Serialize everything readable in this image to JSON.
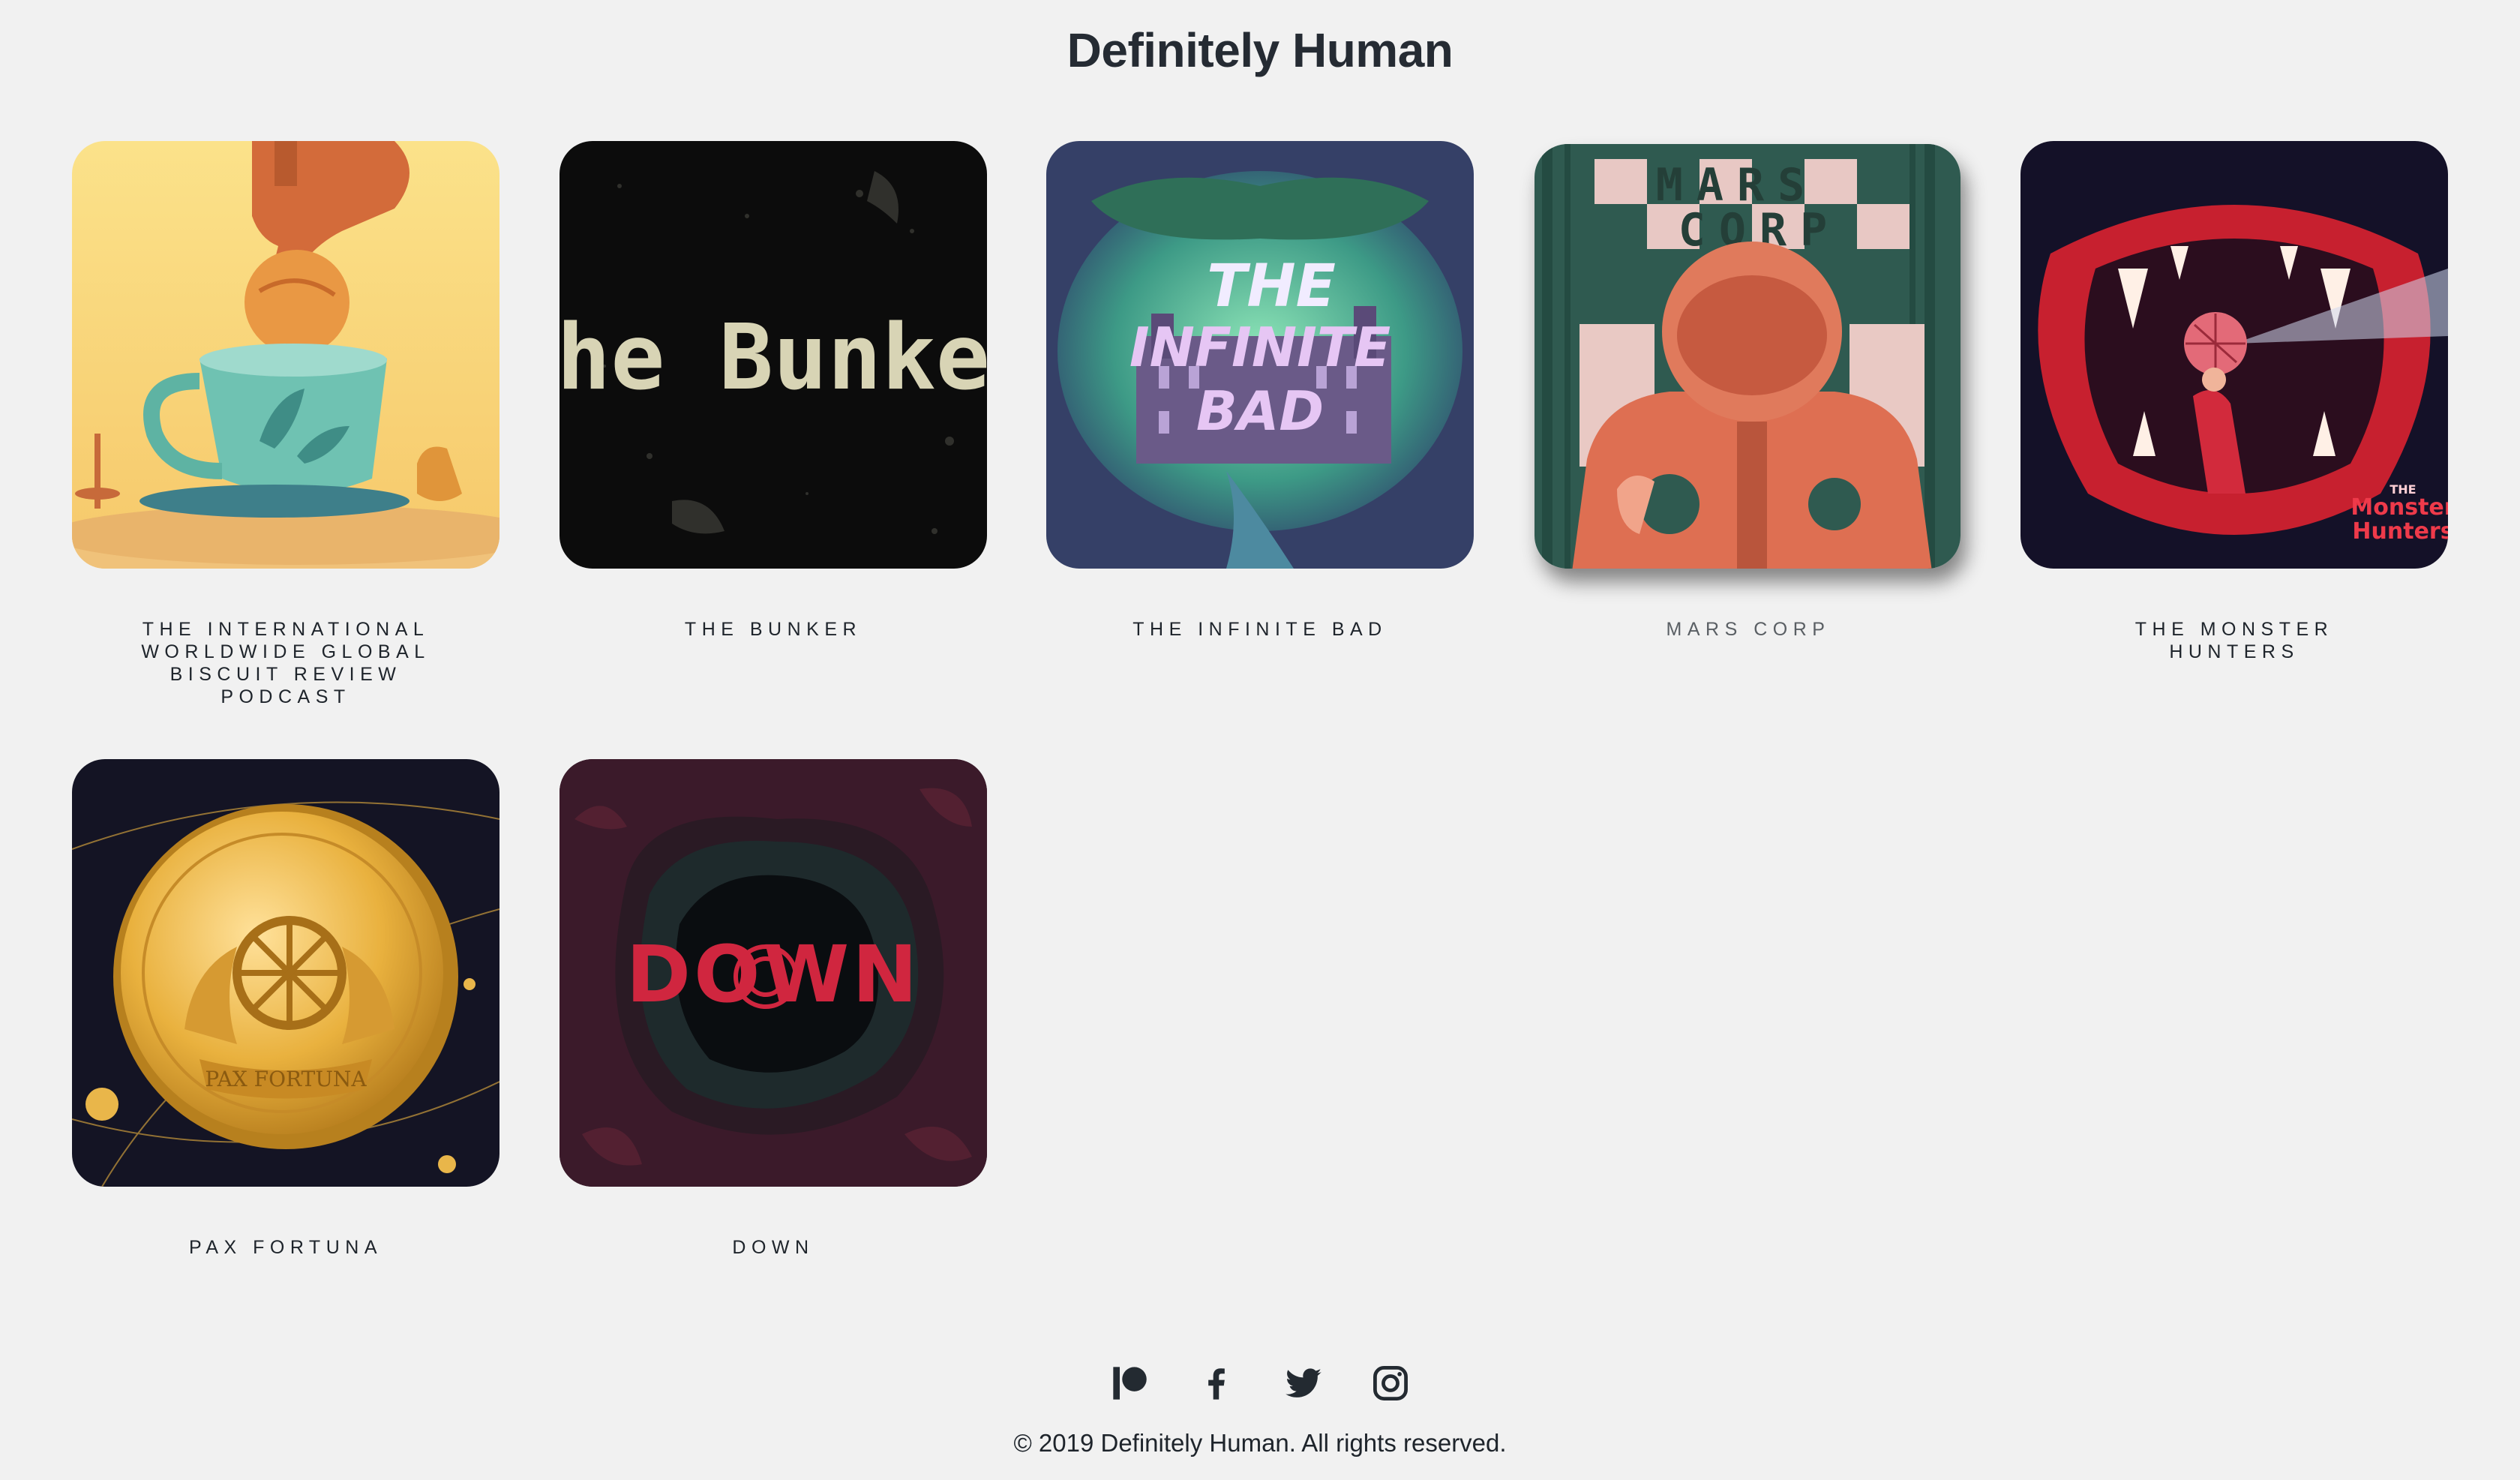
{
  "site": {
    "title": "Definitely Human"
  },
  "podcasts": [
    {
      "title": "THE INTERNATIONAL WORLDWIDE GLOBAL BISCUIT REVIEW PODCAST"
    },
    {
      "title": "THE BUNKER",
      "art_text": "The Bunker"
    },
    {
      "title": "THE INFINITE BAD",
      "art_text": [
        "THE",
        "INFINITE",
        "BAD"
      ]
    },
    {
      "title": "MARS CORP",
      "art_text": [
        "MARS",
        "CORP"
      ]
    },
    {
      "title": "THE MONSTER HUNTERS",
      "art_text": [
        "THE",
        "Monster",
        "Hunters"
      ]
    },
    {
      "title": "PAX FORTUNA",
      "art_text": "PAX FORTUNA"
    },
    {
      "title": "DOWN",
      "art_text": "DOWN"
    }
  ],
  "footer": {
    "social": [
      "patreon-icon",
      "facebook-icon",
      "twitter-icon",
      "instagram-icon"
    ],
    "copyright": "© 2019 Definitely Human. All rights reserved."
  },
  "colors": {
    "background": "#f1f1f1",
    "text": "#252b33"
  }
}
